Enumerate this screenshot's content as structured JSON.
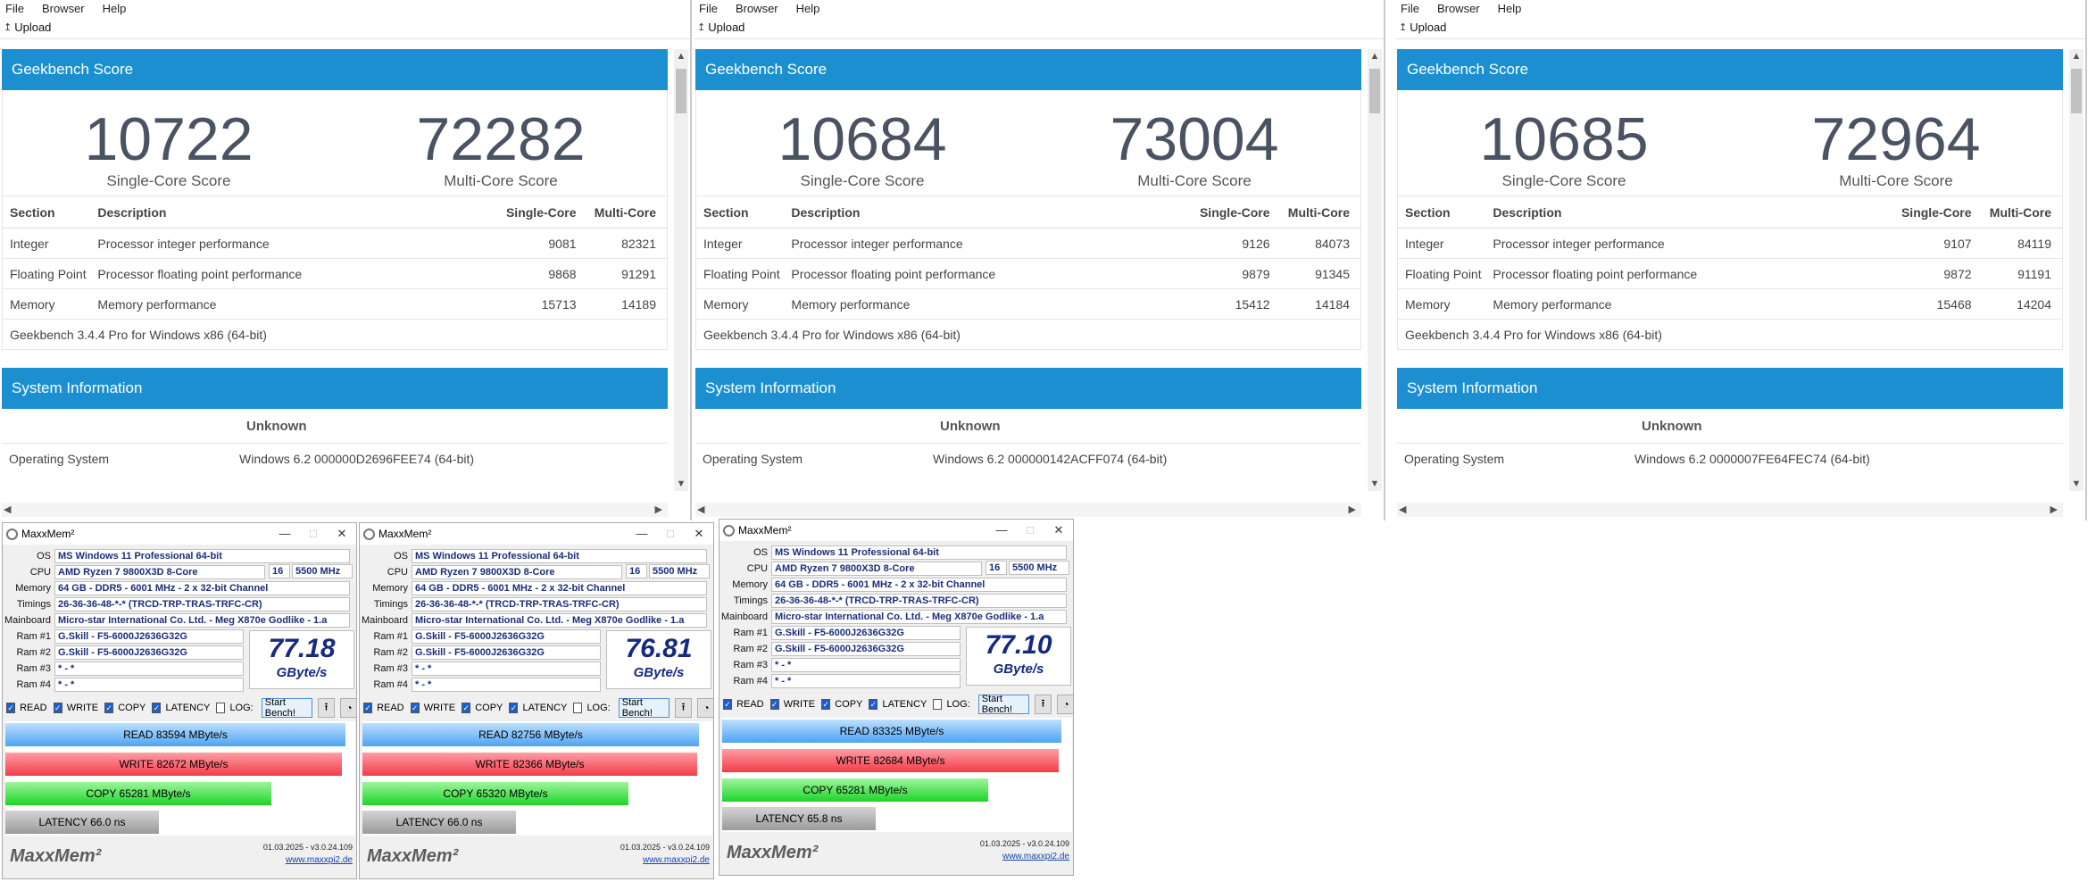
{
  "geekbench": {
    "menu": [
      "File",
      "Browser",
      "Help"
    ],
    "upload_label": "Upload",
    "score_title": "Geekbench Score",
    "single_label": "Single-Core Score",
    "multi_label": "Multi-Core Score",
    "table_headers": {
      "section": "Section",
      "description": "Description",
      "single": "Single-Core",
      "multi": "Multi-Core"
    },
    "version_text": "Geekbench 3.4.4 Pro for Windows x86 (64-bit)",
    "system_title": "System Information",
    "unknown_label": "Unknown",
    "os_key": "Operating System",
    "windows": [
      {
        "single": "10722",
        "multi": "72282",
        "rows": [
          {
            "section": "Integer",
            "description": "Processor integer performance",
            "single": "9081",
            "multi": "82321"
          },
          {
            "section": "Floating Point",
            "description": "Processor floating point performance",
            "single": "9868",
            "multi": "91291"
          },
          {
            "section": "Memory",
            "description": "Memory performance",
            "single": "15713",
            "multi": "14189"
          }
        ],
        "os_value": "Windows 6.2 000000D2696FEE74 (64-bit)"
      },
      {
        "single": "10684",
        "multi": "73004",
        "rows": [
          {
            "section": "Integer",
            "description": "Processor integer performance",
            "single": "9126",
            "multi": "84073"
          },
          {
            "section": "Floating Point",
            "description": "Processor floating point performance",
            "single": "9879",
            "multi": "91345"
          },
          {
            "section": "Memory",
            "description": "Memory performance",
            "single": "15412",
            "multi": "14184"
          }
        ],
        "os_value": "Windows 6.2 000000142ACFF074 (64-bit)"
      },
      {
        "single": "10685",
        "multi": "72964",
        "rows": [
          {
            "section": "Integer",
            "description": "Processor integer performance",
            "single": "9107",
            "multi": "84119"
          },
          {
            "section": "Floating Point",
            "description": "Processor floating point performance",
            "single": "9872",
            "multi": "91191"
          },
          {
            "section": "Memory",
            "description": "Memory performance",
            "single": "15468",
            "multi": "14204"
          }
        ],
        "os_value": "Windows 6.2 0000007FE64FEC74 (64-bit)"
      }
    ]
  },
  "maxxmem": {
    "title": "MaxxMem²",
    "labels": {
      "os": "OS",
      "cpu": "CPU",
      "memory": "Memory",
      "timings": "Timings",
      "mainboard": "Mainboard",
      "ram1": "Ram #1",
      "ram2": "Ram #2",
      "ram3": "Ram #3",
      "ram4": "Ram #4"
    },
    "os": "MS Windows 11 Professional 64-bit",
    "cpu": "AMD Ryzen 7 9800X3D 8-Core",
    "cores": "16",
    "mhz": "5500 MHz",
    "memory": "64 GB - DDR5 - 6001 MHz - 2 x 32-bit Channel",
    "timings": "26-36-36-48-*-* (TRCD-TRP-TRAS-TRFC-CR)",
    "mainboard": "Micro-star International Co. Ltd. - Meg X870e Godlike - 1.a",
    "ram1": "G.Skill - F5-6000J2636G32G",
    "ram2": "G.Skill - F5-6000J2636G32G",
    "ram3": "* - *",
    "ram4": "* - *",
    "unit": "GByte/s",
    "opts": {
      "read": "READ",
      "write": "WRITE",
      "copy": "COPY",
      "latency": "LATENCY",
      "log": "LOG:"
    },
    "start_label": "Start Bench!",
    "logo": "MaxxMem²",
    "date": "01.03.2025 - v3.0.24.109",
    "link": "www.maxxpi2.de",
    "bar_max": 86000,
    "latency_max": 150,
    "windows": [
      {
        "speed": "77.18",
        "read": 83594,
        "read_text": "READ  83594  MByte/s",
        "write": 82672,
        "write_text": "WRITE  82672  MByte/s",
        "copy": 65281,
        "copy_text": "COPY  65281  MByte/s",
        "latency": 66.0,
        "latency_text": "LATENCY  66.0  ns"
      },
      {
        "speed": "76.81",
        "read": 82756,
        "read_text": "READ  82756  MByte/s",
        "write": 82366,
        "write_text": "WRITE  82366  MByte/s",
        "copy": 65320,
        "copy_text": "COPY  65320  MByte/s",
        "latency": 66.0,
        "latency_text": "LATENCY  66.0  ns"
      },
      {
        "speed": "77.10",
        "read": 83325,
        "read_text": "READ  83325  MByte/s",
        "write": 82684,
        "write_text": "WRITE  82684  MByte/s",
        "copy": 65281,
        "copy_text": "COPY  65281  MByte/s",
        "latency": 65.8,
        "latency_text": "LATENCY  65.8  ns"
      }
    ]
  }
}
